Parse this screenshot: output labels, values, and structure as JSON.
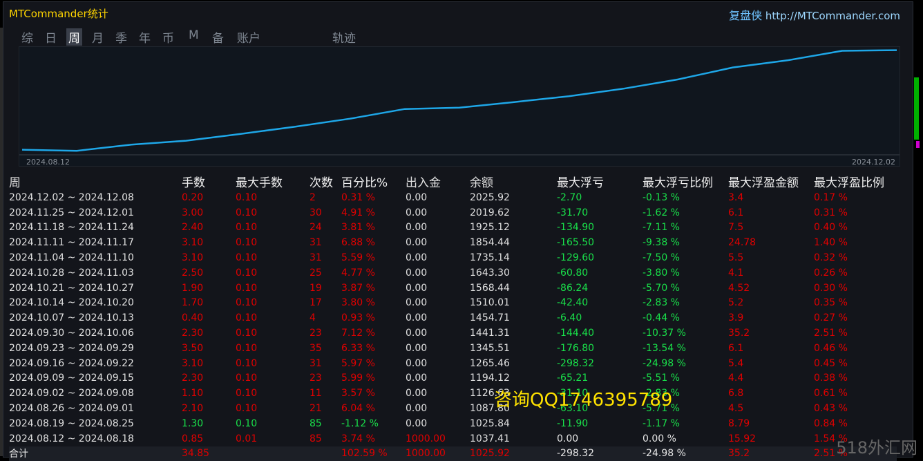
{
  "header": {
    "title": "MTCommander统计",
    "brand": "复盘侠",
    "url": "http://MTCommander.com"
  },
  "tabs": [
    "综",
    "日",
    "周",
    "月",
    "季",
    "年",
    "币",
    "M",
    "备",
    "账户",
    "轨迹"
  ],
  "active_tab": "周",
  "chart": {
    "start_label": "2024.08.12",
    "end_label": "2024.12.02",
    "line_color": "#1ea7e8",
    "balances": [
      1037.41,
      1025.84,
      1087.8,
      1126.63,
      1194.12,
      1265.46,
      1345.51,
      1441.31,
      1454.71,
      1510.01,
      1568.44,
      1643.3,
      1735.14,
      1854.44,
      1925.12,
      2019.62,
      2025.92
    ]
  },
  "table": {
    "headers": [
      "周",
      "手数",
      "最大手数",
      "次数",
      "百分比%",
      "出入金",
      "余额",
      "最大浮亏",
      "最大浮亏比例",
      "最大浮盈金额",
      "最大浮盈比例"
    ],
    "rows": [
      [
        "2024.12.02 ~ 2024.12.08",
        "0.20",
        "0.10",
        "2",
        "0.31 %",
        "0.00",
        "2025.92",
        "-2.70",
        "-0.13 %",
        "3.4",
        "0.17 %"
      ],
      [
        "2024.11.25 ~ 2024.12.01",
        "3.00",
        "0.10",
        "30",
        "4.91 %",
        "0.00",
        "2019.62",
        "-31.70",
        "-1.62 %",
        "6.1",
        "0.31 %"
      ],
      [
        "2024.11.18 ~ 2024.11.24",
        "2.40",
        "0.10",
        "24",
        "3.81 %",
        "0.00",
        "1925.12",
        "-134.90",
        "-7.11 %",
        "7.5",
        "0.40 %"
      ],
      [
        "2024.11.11 ~ 2024.11.17",
        "3.10",
        "0.10",
        "31",
        "6.88 %",
        "0.00",
        "1854.44",
        "-165.50",
        "-9.38 %",
        "24.78",
        "1.40 %"
      ],
      [
        "2024.11.04 ~ 2024.11.10",
        "3.10",
        "0.10",
        "31",
        "5.59 %",
        "0.00",
        "1735.14",
        "-129.60",
        "-7.50 %",
        "5.5",
        "0.32 %"
      ],
      [
        "2024.10.28 ~ 2024.11.03",
        "2.50",
        "0.10",
        "25",
        "4.77 %",
        "0.00",
        "1643.30",
        "-60.80",
        "-3.80 %",
        "4.1",
        "0.26 %"
      ],
      [
        "2024.10.21 ~ 2024.10.27",
        "1.90",
        "0.10",
        "19",
        "3.87 %",
        "0.00",
        "1568.44",
        "-86.24",
        "-5.70 %",
        "4.52",
        "0.30 %"
      ],
      [
        "2024.10.14 ~ 2024.10.20",
        "1.70",
        "0.10",
        "17",
        "3.80 %",
        "0.00",
        "1510.01",
        "-42.40",
        "-2.83 %",
        "5.2",
        "0.35 %"
      ],
      [
        "2024.10.07 ~ 2024.10.13",
        "0.40",
        "0.10",
        "4",
        "0.93 %",
        "0.00",
        "1454.71",
        "-6.40",
        "-0.44 %",
        "3.9",
        "0.27 %"
      ],
      [
        "2024.09.30 ~ 2024.10.06",
        "2.30",
        "0.10",
        "23",
        "7.12 %",
        "0.00",
        "1441.31",
        "-144.40",
        "-10.37 %",
        "35.2",
        "2.51 %"
      ],
      [
        "2024.09.23 ~ 2024.09.29",
        "3.50",
        "0.10",
        "35",
        "6.33 %",
        "0.00",
        "1345.51",
        "-176.80",
        "-13.54 %",
        "6.1",
        "0.46 %"
      ],
      [
        "2024.09.16 ~ 2024.09.22",
        "3.10",
        "0.10",
        "31",
        "5.97 %",
        "0.00",
        "1265.46",
        "-298.32",
        "-24.98 %",
        "5.4",
        "0.45 %"
      ],
      [
        "2024.09.09 ~ 2024.09.15",
        "2.30",
        "0.10",
        "23",
        "5.99 %",
        "0.00",
        "1194.12",
        "-65.21",
        "-5.51 %",
        "4.4",
        "0.38 %"
      ],
      [
        "2024.09.02 ~ 2024.09.08",
        "1.10",
        "0.10",
        "11",
        "3.57 %",
        "0.00",
        "1126.63",
        "-31.10",
        "-2.83 %",
        "6.8",
        "0.61 %"
      ],
      [
        "2024.08.26 ~ 2024.09.01",
        "2.10",
        "0.10",
        "21",
        "6.04 %",
        "0.00",
        "1087.80",
        "-63.10",
        "-5.71 %",
        "4.5",
        "0.43 %"
      ],
      [
        "2024.08.19 ~ 2024.08.25",
        "1.30",
        "0.10",
        "85",
        "-1.12 %",
        "0.00",
        "1025.84",
        "-11.90",
        "-1.17 %",
        "8.79",
        "0.84 %"
      ],
      [
        "2024.08.12 ~ 2024.08.18",
        "0.85",
        "0.01",
        "85",
        "3.74 %",
        "1000.00",
        "1037.41",
        "0.00",
        "0.00 %",
        "15.92",
        "1.54 %"
      ]
    ],
    "total": [
      "合计",
      "34.85",
      "",
      "",
      "102.59 %",
      "1000.00",
      "1025.92",
      "-298.32",
      "-24.98 %",
      "35.2",
      "2.51 %"
    ]
  },
  "watermark": "咨询QQ1746395789",
  "site_watermark": "518外汇网"
}
